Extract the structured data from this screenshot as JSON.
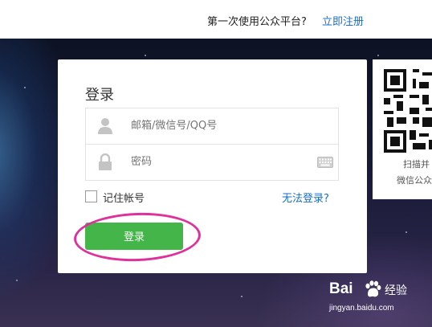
{
  "header": {
    "question": "第一次使用公众平台?",
    "register_link": "立即注册"
  },
  "login": {
    "title": "登录",
    "username_placeholder": "邮箱/微信号/QQ号",
    "password_placeholder": "密码",
    "remember_label": "记住帐号",
    "forgot_link": "无法登录?",
    "submit_label": "登录"
  },
  "qr": {
    "caption_line1": "扫描并",
    "caption_line2": "微信公众"
  },
  "watermark": {
    "brand": "Bai",
    "brand_suffix": "经验",
    "url": "jingyan.baidu.com"
  },
  "colors": {
    "accent_green": "#44b549",
    "link_blue": "#1a6fc7",
    "annotation_pink": "#e0309a"
  }
}
